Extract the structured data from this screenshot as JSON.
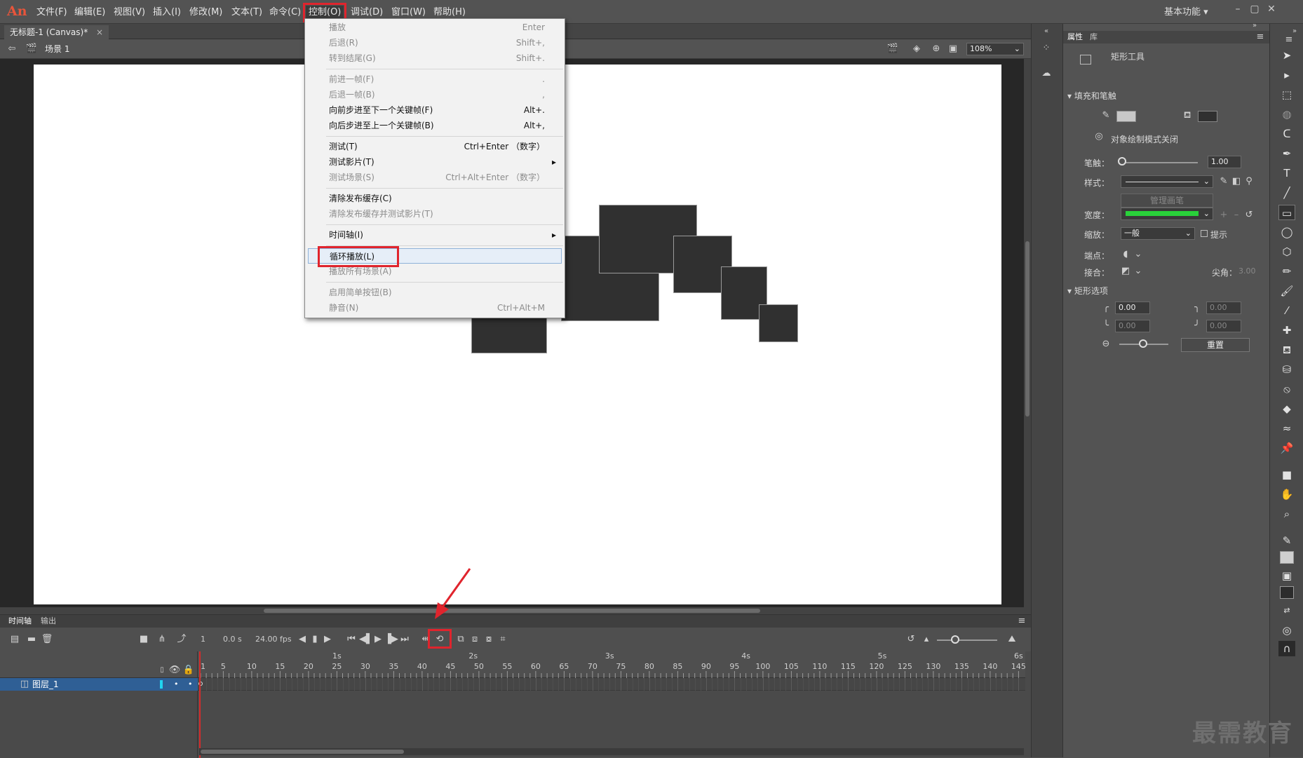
{
  "app": {
    "logo": "An"
  },
  "menubar": {
    "items": [
      "文件(F)",
      "编辑(E)",
      "视图(V)",
      "插入(I)",
      "修改(M)",
      "文本(T)",
      "命令(C)",
      "控制(O)",
      "调试(D)",
      "窗口(W)",
      "帮助(H)"
    ],
    "workspace": "基本功能 ▾"
  },
  "document": {
    "tab_title": "无标题-1 (Canvas)*",
    "scene": "场景 1",
    "zoom": "108%"
  },
  "control_menu": {
    "items": [
      {
        "label": "播放",
        "shortcut": "Enter",
        "disabled": true
      },
      {
        "label": "后退(R)",
        "shortcut": "Shift+,",
        "disabled": true
      },
      {
        "label": "转到结尾(G)",
        "shortcut": "Shift+.",
        "disabled": true
      },
      {
        "label": "前进一帧(F)",
        "shortcut": ".",
        "disabled": true
      },
      {
        "label": "后退一帧(B)",
        "shortcut": ",",
        "disabled": true
      },
      {
        "label": "向前步进至下一个关键帧(F)",
        "shortcut": "Alt+.",
        "disabled": false
      },
      {
        "label": "向后步进至上一个关键帧(B)",
        "shortcut": "Alt+,",
        "disabled": false
      },
      {
        "label": "测试(T)",
        "shortcut": "Ctrl+Enter （数字）",
        "disabled": false
      },
      {
        "label": "测试影片(T)",
        "shortcut": "",
        "submenu": true,
        "disabled": false
      },
      {
        "label": "测试场景(S)",
        "shortcut": "Ctrl+Alt+Enter （数字）",
        "disabled": true
      },
      {
        "label": "清除发布缓存(C)",
        "shortcut": "",
        "disabled": false
      },
      {
        "label": "清除发布缓存并测试影片(T)",
        "shortcut": "",
        "disabled": true
      },
      {
        "label": "时间轴(I)",
        "shortcut": "",
        "submenu": true,
        "disabled": false
      },
      {
        "label": "循环播放(L)",
        "shortcut": "",
        "disabled": false,
        "highlighted": true
      },
      {
        "label": "播放所有场景(A)",
        "shortcut": "",
        "disabled": true
      },
      {
        "label": "启用简单按钮(B)",
        "shortcut": "",
        "disabled": true
      },
      {
        "label": "静音(N)",
        "shortcut": "Ctrl+Alt+M",
        "disabled": true
      }
    ]
  },
  "timeline": {
    "tabs": [
      "时间轴",
      "输出"
    ],
    "current_frame": "1",
    "time": "0.0 s",
    "fps": "24.00 fps",
    "seconds": [
      "1s",
      "2s",
      "3s",
      "4s",
      "5s",
      "6s"
    ],
    "frame_ticks": [
      "1",
      "5",
      "10",
      "15",
      "20",
      "25",
      "30",
      "35",
      "40",
      "45",
      "50",
      "55",
      "60",
      "65",
      "70",
      "75",
      "80",
      "85",
      "90",
      "95",
      "100",
      "105",
      "110",
      "115",
      "120",
      "125",
      "130",
      "135",
      "140",
      "145"
    ],
    "layer_name": "图层_1"
  },
  "properties": {
    "tabs": [
      "属性",
      "库"
    ],
    "tool_name": "矩形工具",
    "fill_stroke_section": "填充和笔触",
    "object_draw_mode": "对象绘制模式关闭",
    "stroke_label": "笔触：",
    "stroke_value": "1.00",
    "style_label": "样式：",
    "manage_brush": "管理画笔",
    "width_label": "宽度：",
    "scale_label": "缩放：",
    "scale_value": "一般",
    "hint_label": "提示",
    "cap_label": "端点：",
    "join_label": "接合：",
    "miter_label": "尖角：",
    "miter_value": "3.00",
    "rect_options_section": "矩形选项",
    "corner_tl": "0.00",
    "corner_tr": "0.00",
    "corner_bl": "0.00",
    "corner_br": "0.00",
    "reset_label": "重置",
    "stroke_color": "#c8c8c8",
    "fill_color": "#303030",
    "width_line_color": "#29d13a"
  },
  "watermark": "最需教育"
}
